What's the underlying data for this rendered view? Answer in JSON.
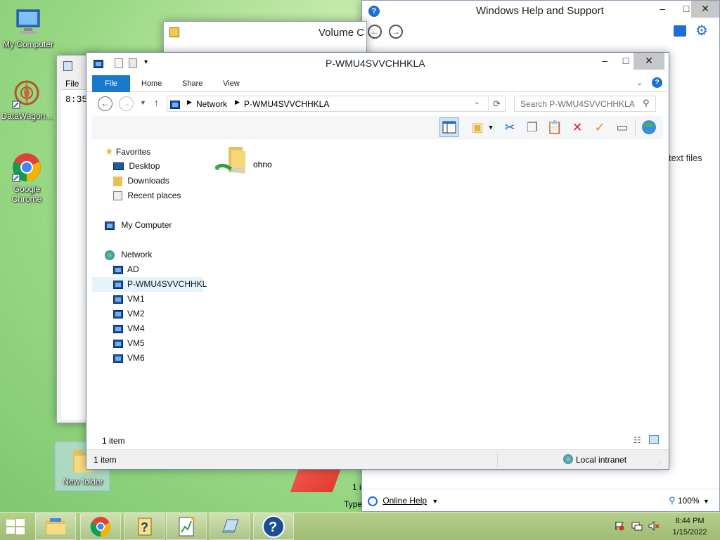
{
  "desktop": {
    "icons": [
      {
        "label": "My Computer"
      },
      {
        "label": "DataWagon..."
      },
      {
        "label": "Google Chrome"
      },
      {
        "label": "New folder"
      }
    ]
  },
  "help_window": {
    "title": "Windows Help and Support",
    "right_text": "text files",
    "status_left": "1 i",
    "status_left2": "Type",
    "online_help": "Online Help",
    "zoom": "100%"
  },
  "volume_window": {
    "title": "Volume C"
  },
  "notepad_window": {
    "menu_file": "File",
    "content": "8:35"
  },
  "explorer": {
    "title": "P-WMU4SVVCHHKLA",
    "ribbon_tabs": [
      "File",
      "Home",
      "Share",
      "View"
    ],
    "breadcrumb": [
      "Network",
      "P-WMU4SVVCHHKLA"
    ],
    "search_placeholder": "Search P-WMU4SVVCHHKLA",
    "nav": {
      "favorites": "Favorites",
      "favorites_items": [
        "Desktop",
        "Downloads",
        "Recent places"
      ],
      "my_computer": "My Computer",
      "network": "Network",
      "network_items": [
        "AD",
        "P-WMU4SVVCHHKL",
        "VM1",
        "VM2",
        "VM4",
        "VM5",
        "VM6"
      ]
    },
    "files": [
      {
        "name": "ohno"
      }
    ],
    "item_count": "1 item",
    "status_count": "1 item",
    "zone": "Local intranet"
  },
  "taskbar": {
    "time": "8:44 PM",
    "date": "1/15/2022"
  },
  "colors": {
    "ribbon_file": "#1979ca",
    "accent_blue": "#1c6fd6",
    "close_gray": "#c7c7c7"
  }
}
